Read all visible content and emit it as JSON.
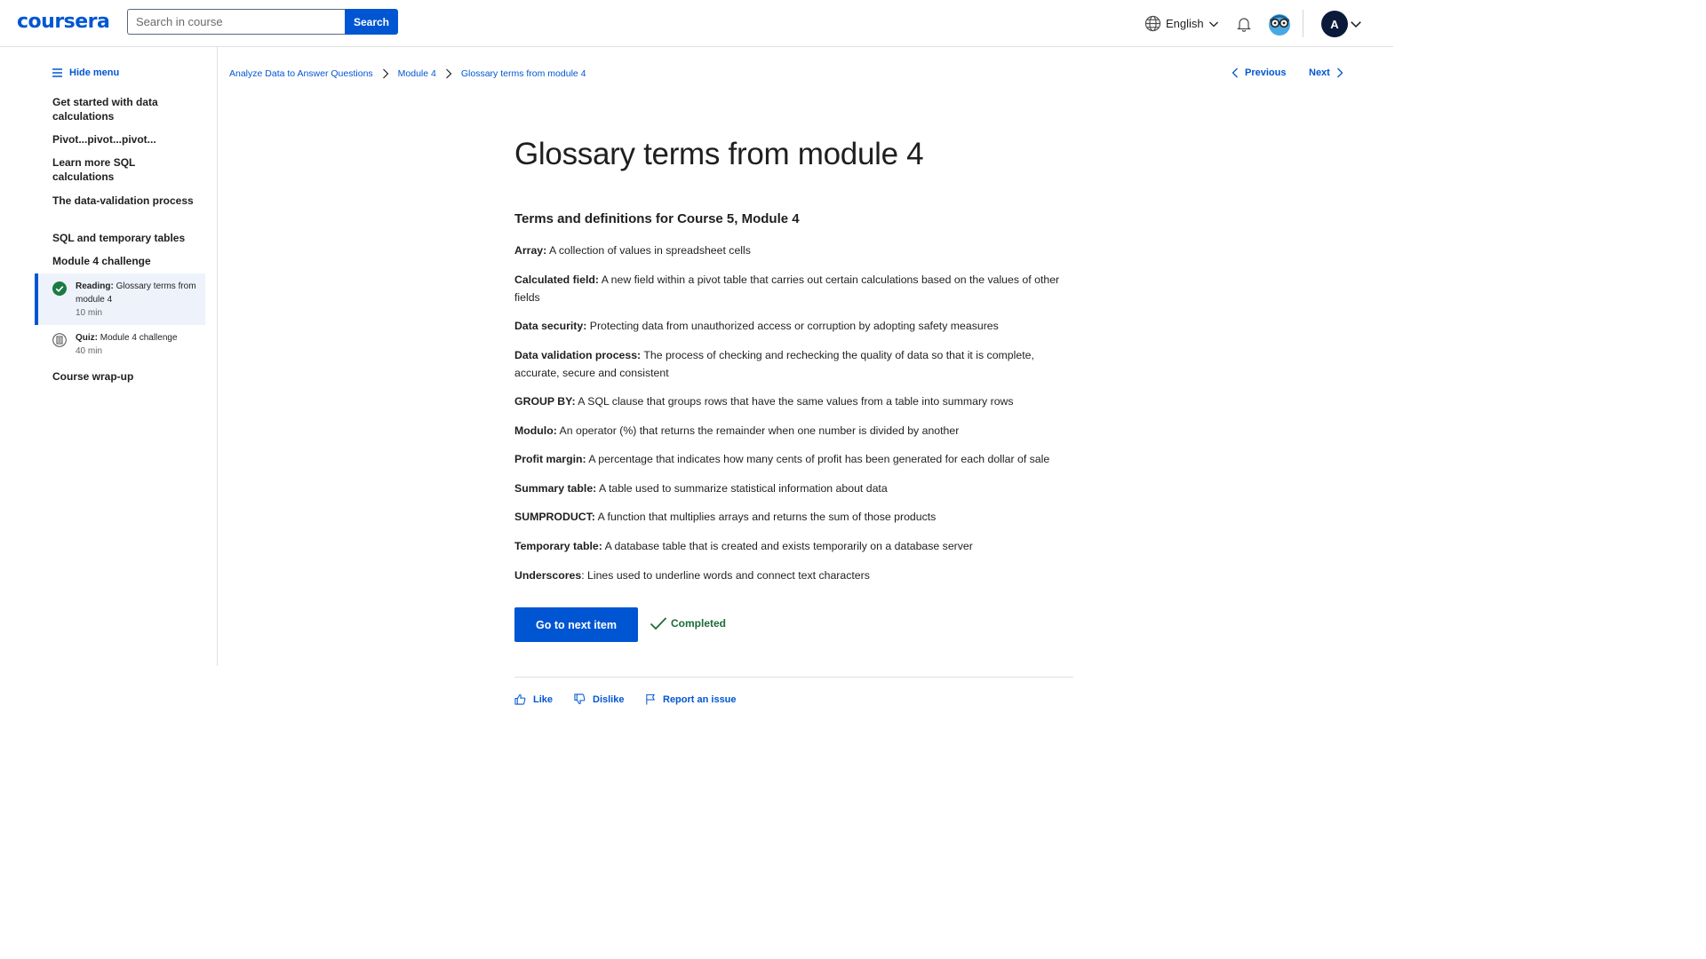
{
  "header": {
    "logo": "coursera",
    "search_placeholder": "Search in course",
    "search_button": "Search",
    "language": "English",
    "avatar_initial": "A"
  },
  "sidebar": {
    "hide_menu": "Hide menu",
    "items": [
      {
        "label": "Get started with data calculations"
      },
      {
        "label": "Pivot...pivot...pivot..."
      },
      {
        "label": "Learn more SQL calculations"
      },
      {
        "label": "The data-validation process"
      },
      {
        "label": "SQL and temporary tables"
      },
      {
        "label": "Module 4 challenge"
      }
    ],
    "sub_items": [
      {
        "type": "Reading:",
        "title": "Glossary terms from module 4",
        "duration": "10 min",
        "icon": "check-circle-icon"
      },
      {
        "type": "Quiz:",
        "title": "Module 4 challenge",
        "duration": "40 min",
        "icon": "quiz-icon"
      }
    ],
    "last_item": "Course wrap-up"
  },
  "breadcrumb": [
    "Analyze Data to Answer Questions",
    "Module 4",
    "Glossary terms from module 4"
  ],
  "nav": {
    "previous": "Previous",
    "next": "Next"
  },
  "content": {
    "title": "Glossary terms from module 4",
    "section_title": "Terms and definitions for Course 5, Module 4",
    "terms": [
      {
        "term": "Array:",
        "definition": " A collection of values in spreadsheet cells"
      },
      {
        "term": "Calculated field:",
        "definition": " A new field within a pivot table that carries out certain calculations based on the values of other fields"
      },
      {
        "term": "Data security:",
        "definition": " Protecting data from unauthorized access or corruption by adopting safety measures"
      },
      {
        "term": "Data validation process:",
        "definition": " The process of checking and rechecking the quality of data so that it is complete, accurate, secure and consistent"
      },
      {
        "term": "GROUP BY:",
        "definition": " A SQL clause that groups rows that have the same values from a table into summary rows"
      },
      {
        "term": "Modulo:",
        "definition": " An operator (%) that returns the remainder when one number is divided by another"
      },
      {
        "term": "Profit margin:",
        "definition": " A percentage that indicates how many cents of profit has been generated for each dollar of sale"
      },
      {
        "term": "Summary table:",
        "definition": " A table used to summarize statistical information about data"
      },
      {
        "term": "SUMPRODUCT:",
        "definition": " A function that multiplies arrays and returns the sum of those products"
      },
      {
        "term": "Temporary table:",
        "definition": " A database table that is created and exists temporarily on a database server"
      },
      {
        "term": "Underscores",
        "definition": ": Lines used to underline words and connect text characters"
      }
    ],
    "next_button": "Go to next item",
    "completed": "Completed"
  },
  "feedback": {
    "like": "Like",
    "dislike": "Dislike",
    "report": "Report an issue"
  },
  "colors": {
    "brand": "#0056d2",
    "completed": "#1b6b3a",
    "active_bg": "#eef3fb"
  }
}
